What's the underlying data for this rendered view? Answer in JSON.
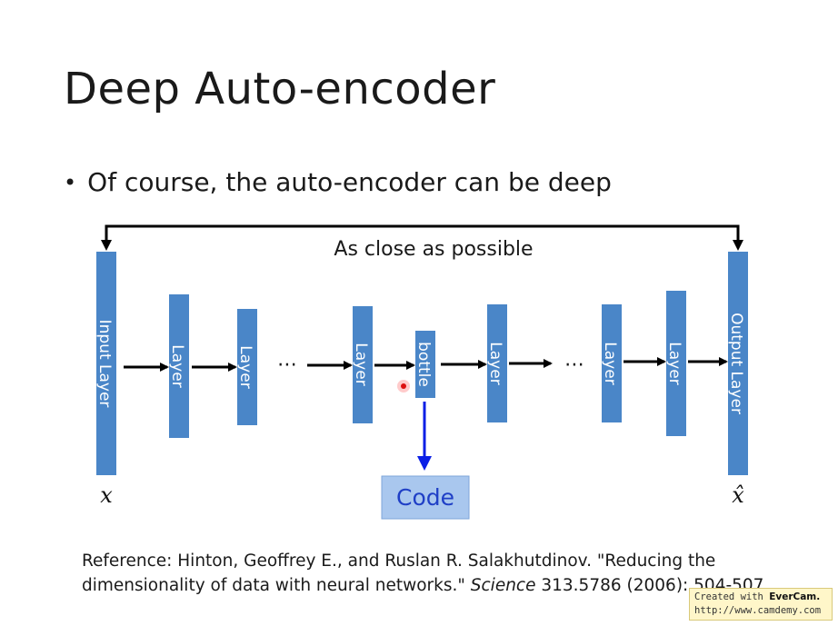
{
  "slide": {
    "title": "Deep Auto-encoder",
    "bullet": "Of course, the auto-encoder can be deep"
  },
  "diagram": {
    "closeness_label": "As close as possible",
    "layers": {
      "input": "Input Layer",
      "layer": "Layer",
      "bottle": "bottle",
      "output": "Output Layer"
    },
    "ellipsis": "⋯",
    "code": "Code",
    "input_symbol": "x",
    "output_symbol": "x̂",
    "colors": {
      "layer_fill": "#4a86c8",
      "code_fill": "#a9c7ee",
      "code_arrow": "#0a1fe6",
      "arrow": "#000000"
    }
  },
  "reference": {
    "prefix": "Reference: Hinton, Geoffrey E., and Ruslan R. Salakhutdinov. \"Reducing the dimensionality of data with neural networks.\" ",
    "journal": "Science",
    "suffix": " 313.5786 (2006): 504-507"
  },
  "watermark": {
    "created_with": "Created with ",
    "brand": "EverCam.",
    "url": "http://www.camdemy.com"
  }
}
